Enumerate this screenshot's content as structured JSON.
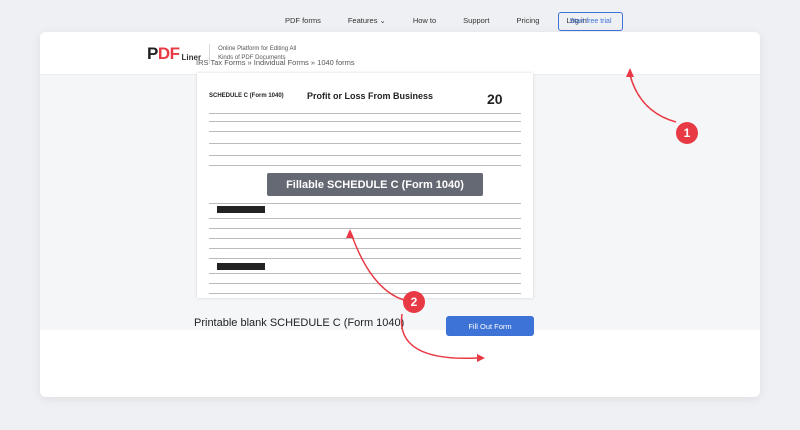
{
  "header": {
    "logo_text_a": "P",
    "logo_text_b": "DF",
    "logo_sub": "Liner",
    "logo_desc": "Online Platform for Editing All Kinds of PDF Documents",
    "nav": [
      "PDF forms",
      "Features ⌄",
      "How to",
      "Support",
      "Pricing",
      "Log in"
    ],
    "trial_label": "Start free trial"
  },
  "breadcrumb": "IRS Tax Forms » Individual Forms » 1040 forms",
  "form_preview": {
    "schedule": "SCHEDULE C (Form 1040)",
    "title": "Profit or Loss From Business",
    "year": "20",
    "overlay_label": "Fillable SCHEDULE C (Form 1040)"
  },
  "bottom": {
    "printable_label": "Printable blank SCHEDULE C (Form 1040)",
    "fill_label": "Fill Out Form"
  },
  "badges": [
    "1",
    "2"
  ],
  "colors": {
    "accent": "#3d73d6",
    "annotation": "#e83a45"
  }
}
